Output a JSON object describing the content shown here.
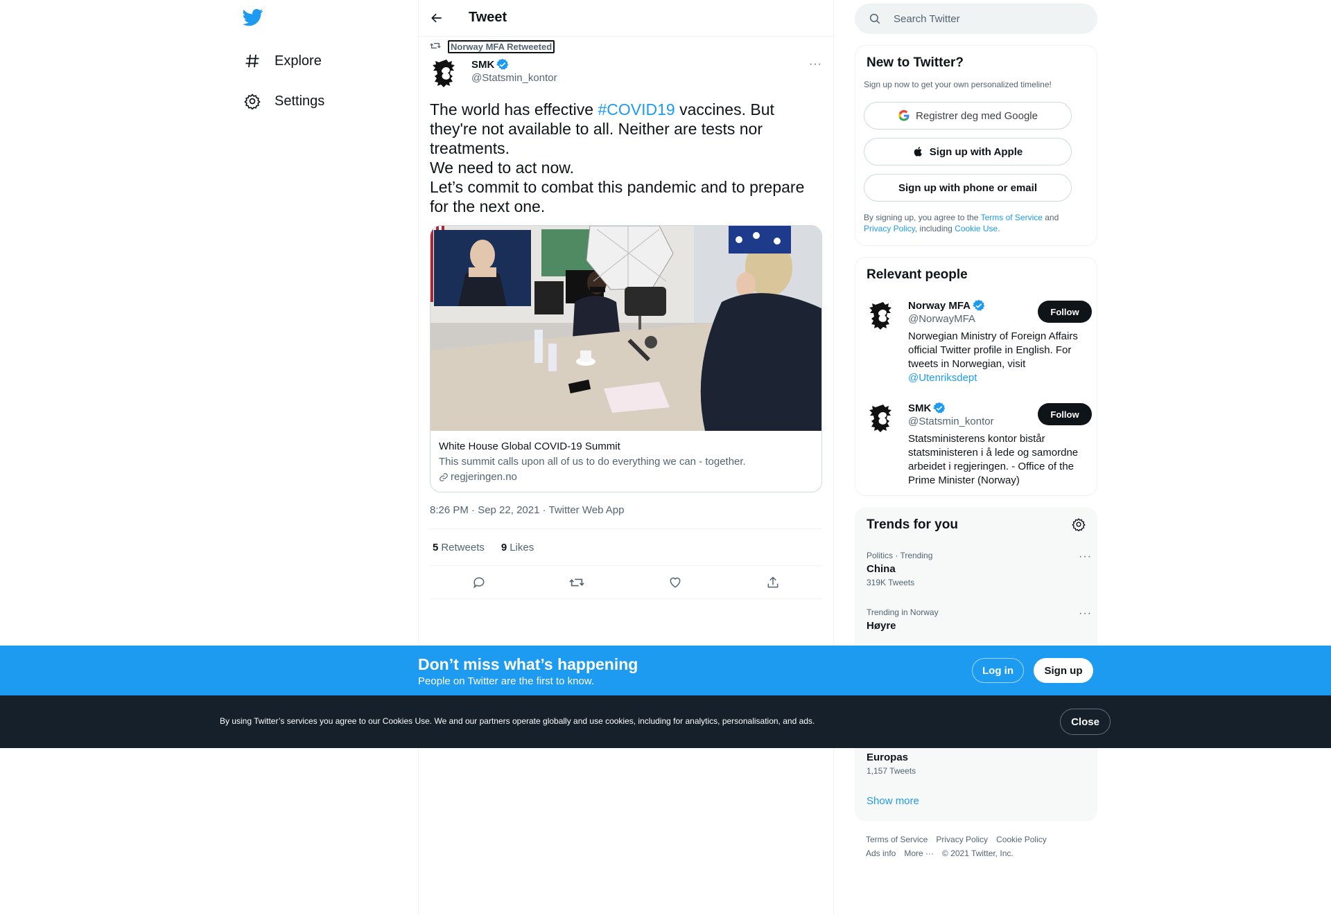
{
  "nav": {
    "logo_icon": "twitter-bird-icon",
    "items": [
      {
        "label": "Explore",
        "icon": "hashtag-icon"
      },
      {
        "label": "Settings",
        "icon": "gear-icon"
      }
    ]
  },
  "header": {
    "title": "Tweet"
  },
  "tweet": {
    "retweeted_by": "Norway MFA Retweeted",
    "author_name": "SMK",
    "author_handle": "@Statsmin_kontor",
    "text_pre": "The world has effective ",
    "hashtag": "#COVID19",
    "text_post": " vaccines. But they're not available to all. Neither are tests nor treatments.",
    "line2": "We need to act now.",
    "line3": "Let’s commit to combat this pandemic and to prepare for the next one.",
    "card": {
      "title": "White House Global COVID-19 Summit",
      "description": "This summit calls upon all of us to do everything we can - together.",
      "domain": "regjeringen.no"
    },
    "meta": "8:26 PM · Sep 22, 2021 · Twitter Web App",
    "retweets_count": "5",
    "retweets_label": "Retweets",
    "likes_count": "9",
    "likes_label": "Likes"
  },
  "search": {
    "placeholder": "Search Twitter"
  },
  "new_to_twitter": {
    "title": "New to Twitter?",
    "subtitle": "Sign up now to get your own personalized timeline!",
    "google_btn": "Registrer deg med Google",
    "apple_btn": "Sign up with Apple",
    "phone_btn": "Sign up with phone or email",
    "legal_1": "By signing up, you agree to the ",
    "legal_tos": "Terms of Service",
    "legal_and": " and ",
    "legal_privacy": "Privacy Policy",
    "legal_including": ", including ",
    "legal_cookie": "Cookie Use."
  },
  "relevant_people": {
    "title": "Relevant people",
    "people": [
      {
        "name": "Norway MFA",
        "handle": "@NorwayMFA",
        "bio": "Norwegian Ministry of Foreign Affairs official Twitter profile in English. For tweets in Norwegian, visit ",
        "bio_link": "@Utenriksdept",
        "follow": "Follow"
      },
      {
        "name": "SMK",
        "handle": "@Statsmin_kontor",
        "bio": "Statsministerens kontor bistår statsministeren i å lede og samordne arbeidet i regjeringen. - Office of the Prime Minister (Norway)",
        "follow": "Follow"
      }
    ]
  },
  "trends": {
    "title": "Trends for you",
    "items": [
      {
        "context": "Politics · Trending",
        "name": "China",
        "count": "319K Tweets"
      },
      {
        "context": "Trending in Norway",
        "name": "Høyre",
        "count": ""
      },
      {
        "context": "",
        "name": "Europas",
        "count": "1,157 Tweets"
      }
    ],
    "show_more": "Show more"
  },
  "footer": {
    "links": [
      "Terms of Service",
      "Privacy Policy",
      "Cookie Policy",
      "Ads info",
      "More ···",
      "© 2021 Twitter, Inc."
    ]
  },
  "bottom_bar": {
    "title": "Don’t miss what’s happening",
    "subtitle": "People on Twitter are the first to know.",
    "login": "Log in",
    "signup": "Sign up"
  },
  "cookie_bar": {
    "text": "By using Twitter’s services you agree to our Cookies Use. We and our partners operate globally and use cookies, including for analytics, personalisation, and ads.",
    "close": "Close"
  },
  "colors": {
    "accent": "#1d9bf0",
    "dark": "#0f1419",
    "muted": "#536471",
    "cookie_bg": "#15202b"
  }
}
